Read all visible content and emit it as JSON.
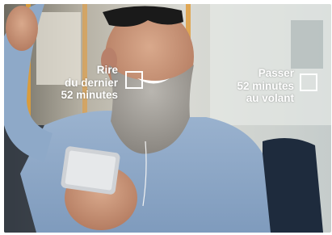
{
  "photo": {
    "subject": "bearded-man-laughing-at-phone-on-bus"
  },
  "choices": [
    {
      "label": "Rire\ndu dernier\n52 minutes",
      "checked": false
    },
    {
      "label": "Passer\n52 minutes\nau volant",
      "checked": false
    }
  ],
  "colors": {
    "label_text": "#ffffff",
    "checkbox_border": "#ffffff",
    "shirt": "#8ea9c8",
    "beard": "#a4a19c"
  }
}
